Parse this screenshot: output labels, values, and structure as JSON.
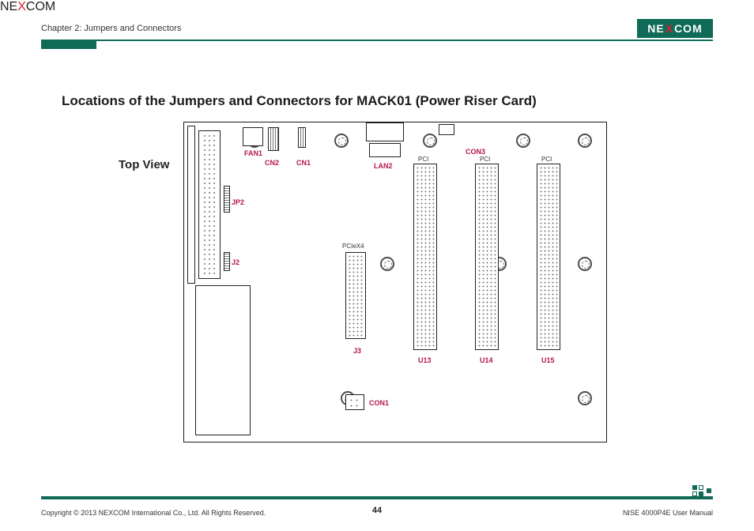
{
  "header": {
    "chapter": "Chapter 2: Jumpers and Connectors",
    "brand_pre": "NE",
    "brand_mid": "X",
    "brand_post": "COM"
  },
  "title": "Locations of the Jumpers and Connectors for MACK01 (Power Riser Card)",
  "top_view": "Top View",
  "labels": {
    "fan1": "FAN1",
    "cn2": "CN2",
    "cn1": "CN1",
    "con3": "CON3",
    "lan2": "LAN2",
    "jp2": "JP2",
    "j2": "J2",
    "j3": "J3",
    "u13": "U13",
    "u14": "U14",
    "u15": "U15",
    "con1": "CON1",
    "pciex4": "PCIeX4",
    "pci1": "PCI",
    "pci2": "PCI",
    "pci3": "PCI"
  },
  "footer": {
    "copyright": "Copyright © 2013 NEXCOM International Co., Ltd. All Rights Reserved.",
    "page": "44",
    "manual": "NISE 4000P4E User Manual"
  }
}
